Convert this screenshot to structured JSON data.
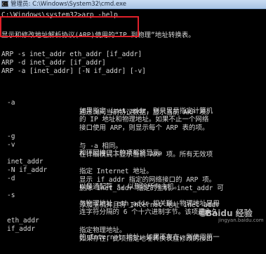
{
  "window": {
    "title": "管理员: C:\\Windows\\System32\\cmd.exe",
    "icon": "cmd-icon"
  },
  "console": {
    "prompt": "C:\\Windows\\system32>arp -help",
    "description": "显示和修改地址解析协议(ARP)使用的“IP 到物理”地址转换表。",
    "usage": [
      "ARP -s inet_addr eth_addr [if_addr]",
      "ARP -d inet_addr [if_addr]",
      "ARP -a [inet_addr] [-N if_addr] [-v]"
    ],
    "options": [
      {
        "flag": "-a",
        "lines": [
          "通过询问当前协议数据，显示当前 ARP 项。",
          "如果指定 inet_addr，则只显示指定计算机",
          "的 IP 地址和物理地址。如果不止一个网络",
          "接口使用 ARP，则显示每个 ARP 表的项。"
        ]
      },
      {
        "flag": "-g",
        "lines": [
          "与 -a 相同。"
        ]
      },
      {
        "flag": "-v",
        "lines": [
          "在详细模式下显示当前 ARP 项。所有无效项",
          "和环回接口上的项都将显示。"
        ]
      },
      {
        "flag": "inet_addr",
        "lines": [
          "指定 Internet 地址。"
        ]
      },
      {
        "flag": "-N if_addr",
        "lines": [
          "显示 if_addr 指定的网络接口的 ARP 项。"
        ]
      },
      {
        "flag": "-d",
        "lines": [
          "删除 inet_addr 指定的主机。inet_addr 可",
          "以是通配符 *，以删除所有主机。"
        ]
      },
      {
        "flag": "-s",
        "lines": [
          "添加主机并且将 Internet 地址 inet_addr",
          "与物理地址 eth_addr 相关联。物理地址是用",
          "连字符分隔的 6 个十六进制字节。该项是永久"
        ]
      },
      {
        "flag": "eth_addr",
        "lines": [
          "指定物理地址。"
        ]
      },
      {
        "flag": "if_addr",
        "lines": [
          "如果存在，此项指定地址转换表应修改的接口",
          "的 Internet 地址。如果不存在，则使用第一"
        ]
      }
    ]
  },
  "watermark": {
    "brand": "Baidu 经验",
    "sub": "jingyan.baidu.com"
  },
  "colors": {
    "console_bg": "#000000",
    "console_text": "#d8d8d8",
    "highlight_border": "#e0202a"
  }
}
